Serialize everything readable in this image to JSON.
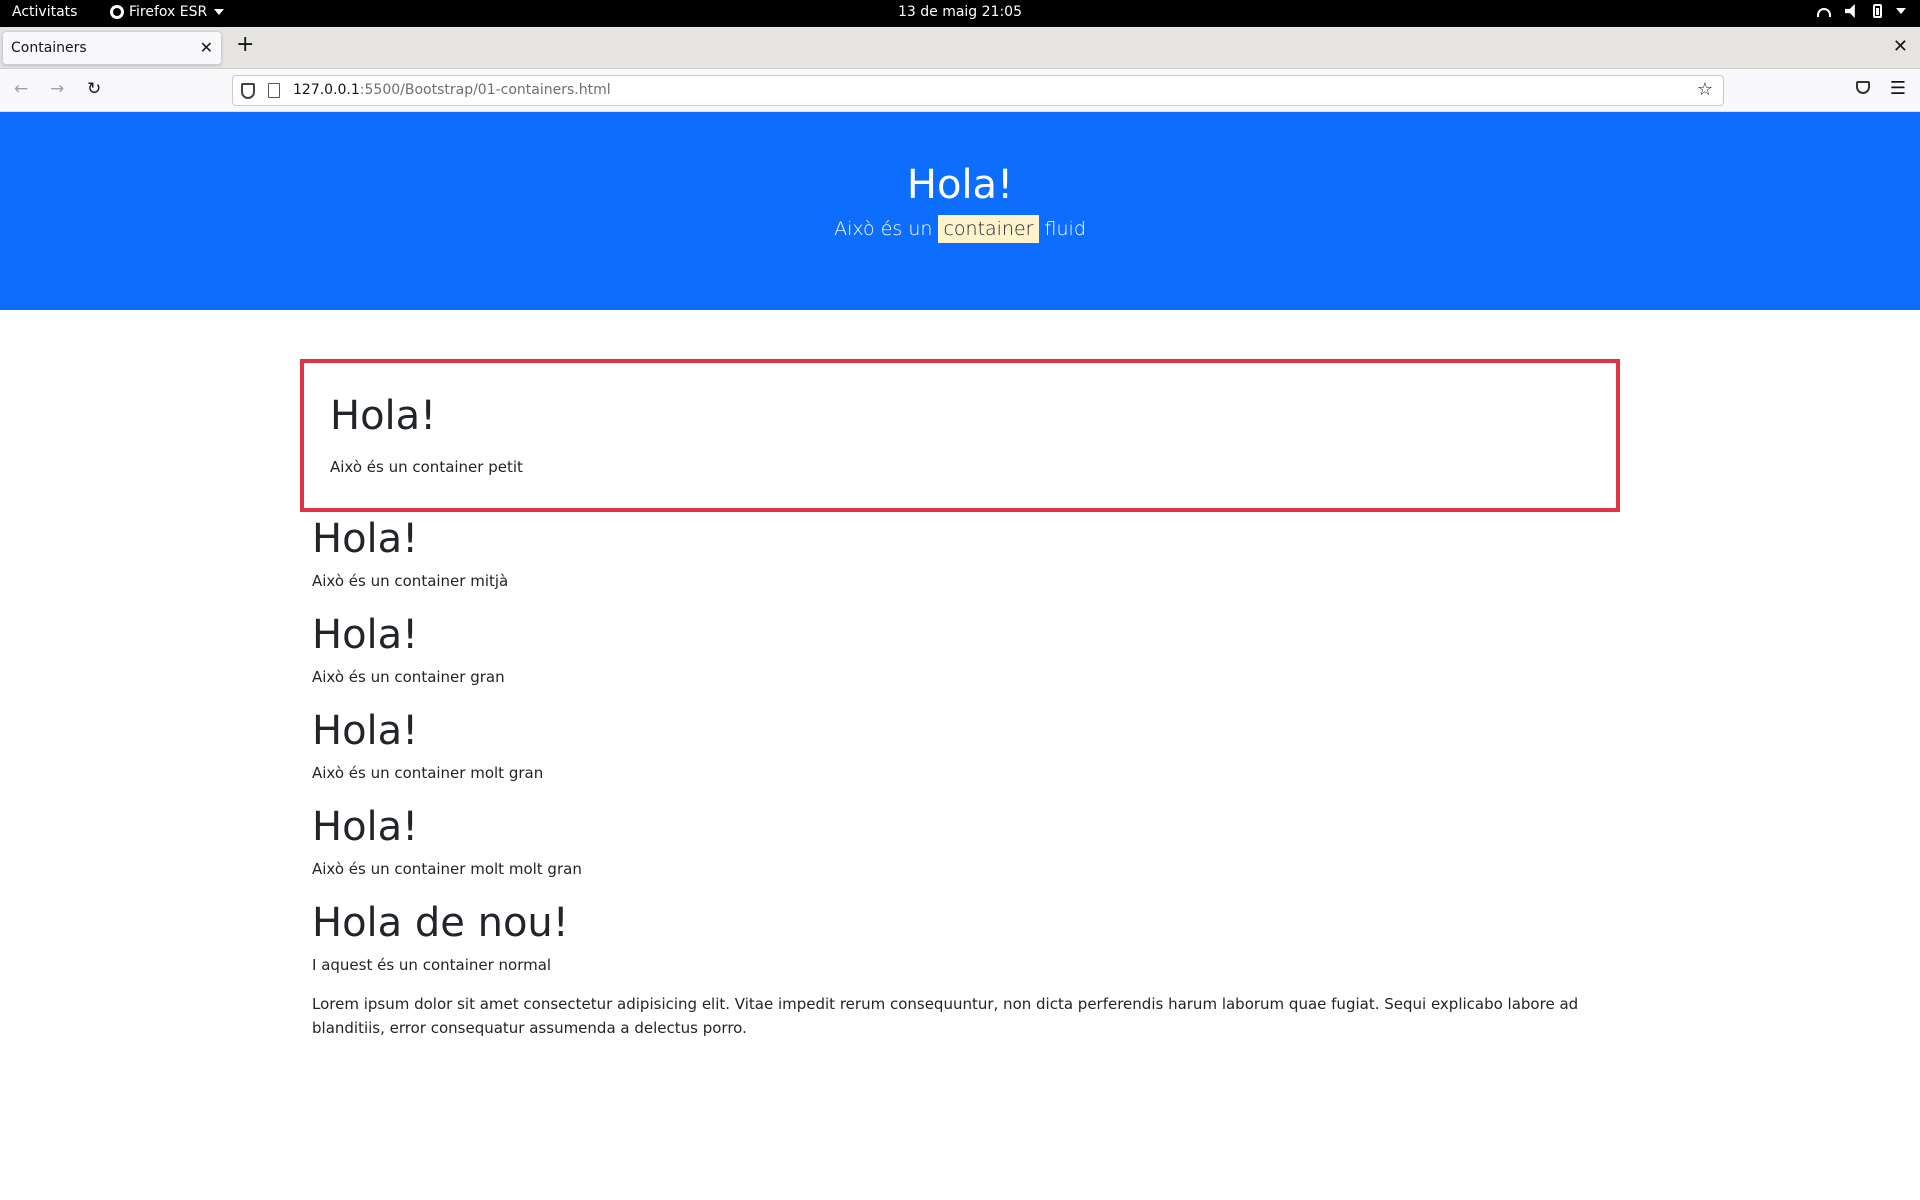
{
  "topbar": {
    "activities": "Activitats",
    "app_name": "Firefox ESR",
    "clock": "13 de maig  21:05"
  },
  "browser": {
    "tab_title": "Containers",
    "url_host": "127.0.0.1",
    "url_rest": ":5500/Bootstrap/01-containers.html"
  },
  "hero": {
    "heading": "Hola!",
    "lead_before": "Això és un ",
    "lead_mark": "container",
    "lead_after": " fluid"
  },
  "sections": [
    {
      "heading": "Hola!",
      "text": "Això és un container petit"
    },
    {
      "heading": "Hola!",
      "text": "Això és un container mitjà"
    },
    {
      "heading": "Hola!",
      "text": "Això és un container gran"
    },
    {
      "heading": "Hola!",
      "text": "Això és un container molt gran"
    },
    {
      "heading": "Hola!",
      "text": "Això és un container molt molt gran"
    },
    {
      "heading": "Hola de nou!",
      "text": "I aquest és un container normal"
    }
  ],
  "lorem": "Lorem ipsum dolor sit amet consectetur adipisicing elit. Vitae impedit rerum consequuntur, non dicta perferendis harum laborum quae fugiat. Sequi explicabo labore ad blanditiis, error consequatur assumenda a delectus porro.",
  "colors": {
    "hero_bg": "#0d6efd",
    "highlight": "#fff3cd",
    "border_danger": "#dc3545"
  }
}
